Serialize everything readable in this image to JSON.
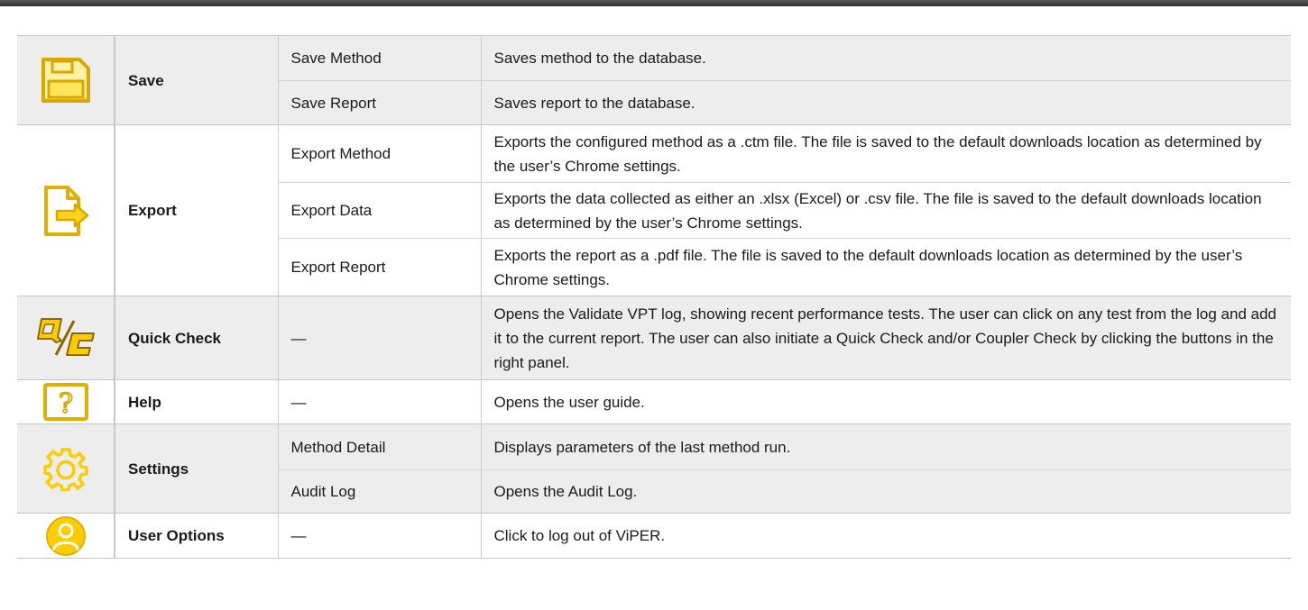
{
  "rows": {
    "save": {
      "function": "Save",
      "icon": "save-icon",
      "options": [
        {
          "option": "Save Method",
          "description": "Saves method to the database."
        },
        {
          "option": "Save Report",
          "description": "Saves report to the database."
        }
      ]
    },
    "export": {
      "function": "Export",
      "icon": "export-file-icon",
      "options": [
        {
          "option": "Export Method",
          "description": "Exports the configured method as a .ctm file. The file is saved to the default downloads location as determined by the user’s Chrome settings."
        },
        {
          "option": "Export Data",
          "description": "Exports the data collected as either an .xlsx (Excel) or .csv file. The file is saved to the default downloads location as determined by the user’s Chrome settings."
        },
        {
          "option": "Export Report",
          "description": "Exports the report as a .pdf file. The file is saved to the default downloads location as determined by the user’s Chrome settings."
        }
      ]
    },
    "quick_check": {
      "function": "Quick Check",
      "icon": "quick-check-icon",
      "option": "—",
      "description": "Opens the Validate VPT log, showing recent performance tests. The user can click on any test from the log and add it to the current report. The user can also initiate a Quick Check and/or Coupler Check by clicking the buttons in the right panel."
    },
    "help": {
      "function": "Help",
      "icon": "help-icon",
      "option": "—",
      "description": "Opens the user guide."
    },
    "settings": {
      "function": "Settings",
      "icon": "gear-icon",
      "options": [
        {
          "option": "Method Detail",
          "description": "Displays parameters of the last method run."
        },
        {
          "option": "Audit Log",
          "description": "Opens the Audit Log."
        }
      ]
    },
    "user_options": {
      "function": "User Options",
      "icon": "user-icon",
      "option": "—",
      "description": "Click to log out of ViPER."
    }
  },
  "colors": {
    "accent_yellow": "#f5c400",
    "accent_dark": "#8a6a00",
    "shade": "#ededed"
  }
}
